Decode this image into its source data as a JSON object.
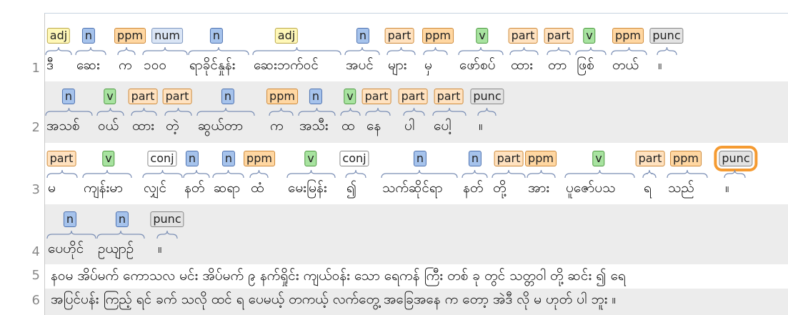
{
  "lines": [
    {
      "number": "1",
      "tokens": [
        {
          "tag": "adj",
          "text": "ဒီ"
        },
        {
          "tag": "n",
          "text": "ဆေး"
        },
        {
          "tag": "ppm",
          "text": "က"
        },
        {
          "tag": "num",
          "text": "၁၀၀"
        },
        {
          "tag": "n",
          "text": "ရာခိုင်နှုန်း"
        },
        {
          "tag": "adj",
          "text": "ဆေးဘက်ဝင်"
        },
        {
          "tag": "n",
          "text": "အပင်"
        },
        {
          "tag": "part",
          "text": "များ"
        },
        {
          "tag": "ppm",
          "text": "မှ"
        },
        {
          "tag": "v",
          "text": "ဖော်စပ်"
        },
        {
          "tag": "part",
          "text": "ထား"
        },
        {
          "tag": "part",
          "text": "တာ"
        },
        {
          "tag": "v",
          "text": "ဖြစ်"
        },
        {
          "tag": "ppm",
          "text": "တယ်"
        },
        {
          "tag": "punc",
          "text": "။"
        }
      ]
    },
    {
      "number": "2",
      "tokens": [
        {
          "tag": "n",
          "text": "အသစ်"
        },
        {
          "tag": "v",
          "text": "ဝယ်"
        },
        {
          "tag": "part",
          "text": "ထား"
        },
        {
          "tag": "part",
          "text": "တဲ့"
        },
        {
          "tag": "n",
          "text": "ဆွယ်တာ"
        },
        {
          "tag": "ppm",
          "text": "က"
        },
        {
          "tag": "n",
          "text": "အသီး"
        },
        {
          "tag": "v",
          "text": "ထ"
        },
        {
          "tag": "part",
          "text": "နေ"
        },
        {
          "tag": "part",
          "text": "ပါ"
        },
        {
          "tag": "part",
          "text": "ပေါ့"
        },
        {
          "tag": "punc",
          "text": "။"
        }
      ]
    },
    {
      "number": "3",
      "tokens": [
        {
          "tag": "part",
          "text": "မ"
        },
        {
          "tag": "v",
          "text": "ကျန်းမာ"
        },
        {
          "tag": "conj",
          "text": "လျှင်"
        },
        {
          "tag": "n",
          "text": "နတ်"
        },
        {
          "tag": "n",
          "text": "ဆရာ"
        },
        {
          "tag": "ppm",
          "text": "ထံ"
        },
        {
          "tag": "v",
          "text": "မေးမြန်း"
        },
        {
          "tag": "conj",
          "text": "၍"
        },
        {
          "tag": "n",
          "text": "သက်ဆိုင်ရာ"
        },
        {
          "tag": "n",
          "text": "နတ်"
        },
        {
          "tag": "part",
          "text": "တို့"
        },
        {
          "tag": "ppm",
          "text": "အား"
        },
        {
          "tag": "v",
          "text": "ပူဇော်ပသ"
        },
        {
          "tag": "part",
          "text": "ရ"
        },
        {
          "tag": "ppm",
          "text": "သည်"
        },
        {
          "tag": "punc",
          "text": "။"
        }
      ]
    },
    {
      "number": "4",
      "tokens": [
        {
          "tag": "n",
          "text": "ပေဟိုင်"
        },
        {
          "tag": "n",
          "text": "ဥယျာဉ်"
        },
        {
          "tag": "punc",
          "text": "။"
        }
      ]
    },
    {
      "number": "5",
      "text": "နဝမ အိပ်မက် ကောသလ မင်း အိပ်မက် ၉ နက်ရှိုင်း ကျယ်ဝန်း သော ရေကန် ကြီး တစ် ခု တွင် သတ္တဝါ တို့ ဆင်း ၍ ရေ"
    },
    {
      "number": "6",
      "text": "အပြင်ပန်း ကြည့် ရင် ခက် သလို ထင် ရ ပေမယ့် တကယ့် လက်တွေ့ အခြေအနေ က တော့ အဲဒီ လို မ ဟုတ် ပါ ဘူး ။"
    }
  ]
}
